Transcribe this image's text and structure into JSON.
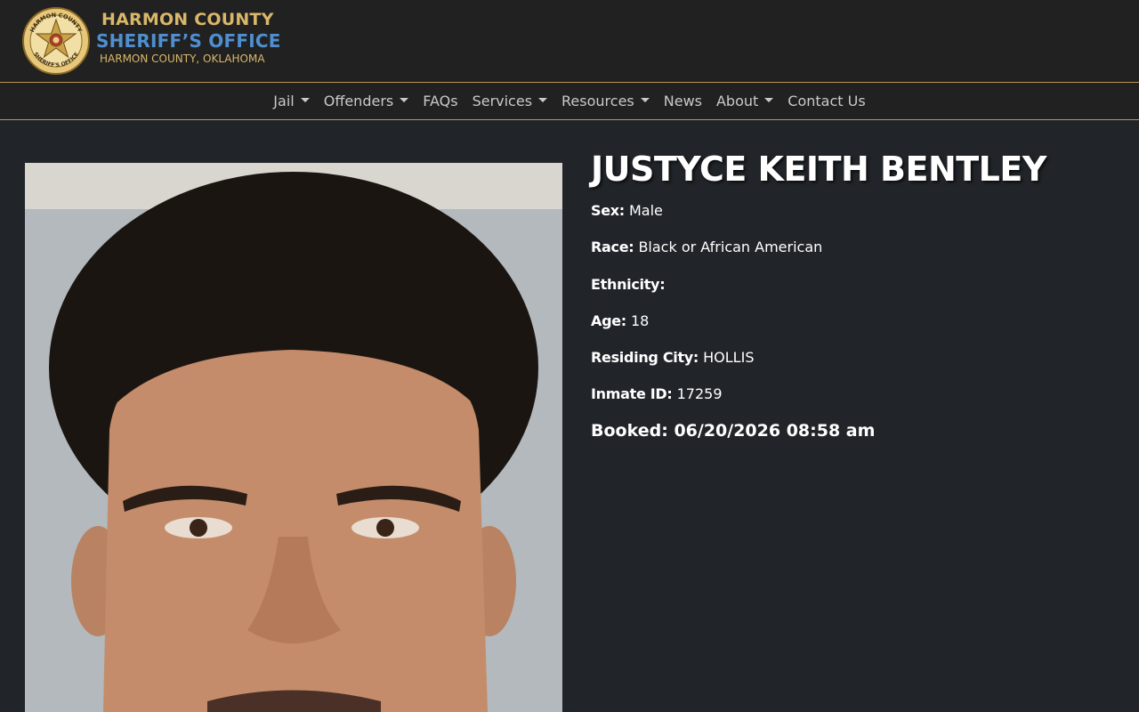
{
  "header": {
    "seal_top_text": "HARMON COUNTY",
    "seal_bottom_text": "SHERIFF'S OFFICE",
    "brand_line1": "HARMON COUNTY",
    "brand_line2": "SHERIFF’S OFFICE",
    "brand_line3": "HARMON COUNTY, OKLAHOMA"
  },
  "nav": {
    "items": [
      {
        "label": "Jail",
        "dropdown": true
      },
      {
        "label": "Offenders",
        "dropdown": true
      },
      {
        "label": "FAQs",
        "dropdown": false
      },
      {
        "label": "Services",
        "dropdown": true
      },
      {
        "label": "Resources",
        "dropdown": true
      },
      {
        "label": "News",
        "dropdown": false
      },
      {
        "label": "About",
        "dropdown": true
      },
      {
        "label": "Contact Us",
        "dropdown": false
      }
    ]
  },
  "inmate": {
    "name": "JUSTYCE KEITH BENTLEY",
    "sex_label": "Sex:",
    "sex": "Male",
    "race_label": "Race:",
    "race": "Black or African American",
    "ethnicity_label": "Ethnicity:",
    "ethnicity": "",
    "age_label": "Age:",
    "age": "18",
    "city_label": "Residing City:",
    "city": "HOLLIS",
    "id_label": "Inmate ID:",
    "id": "17259",
    "booked_label": "Booked:",
    "booked": "06/20/2026 08:58 am"
  },
  "colors": {
    "page_bg": "#212529",
    "header_bg": "#212121",
    "gold": "#d9b76a",
    "blue": "#4f8fd1",
    "nav_text": "#c9c9c9"
  },
  "icons": {
    "seal": "sheriff-star-seal",
    "dropdown": "caret-down"
  }
}
